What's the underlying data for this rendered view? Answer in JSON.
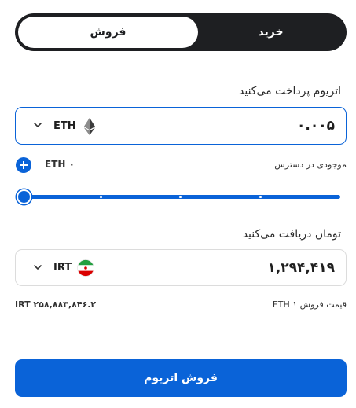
{
  "tabs": {
    "sell": "فروش",
    "buy": "خرید"
  },
  "pay": {
    "label": "اتریوم پرداخت می‌کنید",
    "amount": "۰.۰۰۵",
    "currency": "ETH",
    "currency_icon": "ethereum-icon",
    "available_label": "موجودی در دسترس",
    "available_value": "ETH ۰"
  },
  "slider": {
    "value": 0,
    "steps": 5
  },
  "receive": {
    "label": "تومان دریافت می‌کنید",
    "amount": "۱,۲۹۴,۴۱۹",
    "currency": "IRT",
    "currency_icon": "iran-flag-icon"
  },
  "rate": {
    "label": "قیمت فروش ۱ ETH",
    "value": "۲۵۸,۸۸۳,۸۴۶.۲ IRT"
  },
  "submit_label": "فروش اتریوم",
  "colors": {
    "accent": "#0a63d8",
    "toggle_bg": "#1e1f22"
  }
}
